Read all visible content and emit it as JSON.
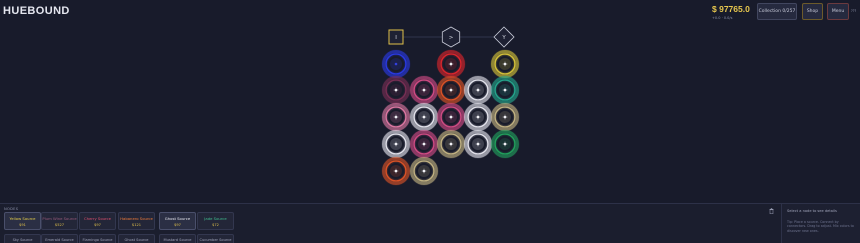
{
  "header": {
    "title": "HUEBOUND",
    "money": "$ 97765.0",
    "rate": "+0.0 · 0.0/s",
    "collection_label": "Collection 0/257",
    "shop_label": "Shop",
    "menu_label": "Menu",
    "corner_text": "???"
  },
  "palette": {
    "blue": "#2a3be8",
    "red": "#e0262c",
    "yellow": "#d9c63a",
    "pink": "#d64d86",
    "teal": "#25a98e",
    "orange": "#e05426",
    "white": "#e8e8f0",
    "plum": "#7a2f55",
    "khaki": "#c6b684",
    "green": "#22a45e",
    "rose": "#e27aa5"
  },
  "board": {
    "tools": [
      {
        "name": "tool-square",
        "glyph": "I"
      },
      {
        "name": "tool-hexagon",
        "glyph": ">"
      },
      {
        "name": "tool-diamond",
        "glyph": "Y"
      }
    ],
    "grid": [
      [
        "blue",
        null,
        "red",
        null,
        "yellow"
      ],
      [
        "plum",
        "pink",
        "orange",
        "white",
        "teal"
      ],
      [
        "rose",
        "white",
        "pink",
        "white",
        "khaki"
      ],
      [
        "white",
        "pink",
        "khaki",
        "white",
        "green"
      ],
      [
        "orange",
        "khaki",
        null,
        null,
        null
      ]
    ]
  },
  "bottom": {
    "nodes_label": "NODES",
    "cards": [
      {
        "name": "Yellow Source",
        "price": "$91",
        "color": "#e6cf4a"
      },
      {
        "name": "Plum Wine Source",
        "price": "$527",
        "color": "#9a5a7c"
      },
      {
        "name": "Cherry Source",
        "price": "$97",
        "color": "#e05070"
      },
      {
        "name": "Habanero Source",
        "price": "$121",
        "color": "#ef7a3a"
      },
      {
        "name": "Ghost Source",
        "price": "$97",
        "color": "#e8e8f0"
      },
      {
        "name": "Jade Source",
        "price": "$72",
        "color": "#3fbf8f"
      }
    ],
    "cards_row2": [
      "Sky Source",
      "Emerald Source",
      "Flamingo Source",
      "Ghost Source",
      "Mustard Source",
      "Cucumber Source"
    ],
    "detail_title": "Select a node to see details",
    "detail_hint": "Tip: Place a source. Connect by connectors. Drag to adjust. Mix colors to discover new ones."
  }
}
